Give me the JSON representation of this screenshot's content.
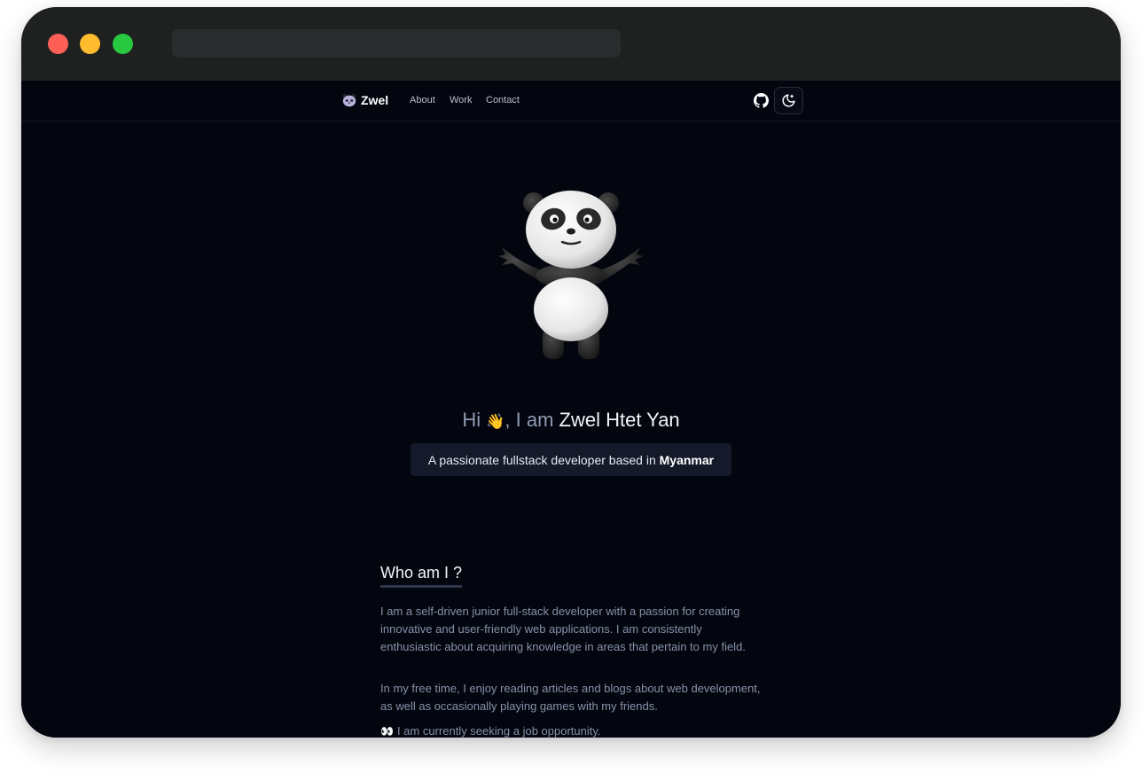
{
  "nav": {
    "brand": "Zwel",
    "links": [
      "About",
      "Work",
      "Contact"
    ]
  },
  "hero": {
    "greeting_prefix": "Hi",
    "wave_emoji": "👋",
    "greeting_mid": ", I am",
    "name": "Zwel Htet Yan",
    "tagline_prefix": "A passionate fullstack developer based in",
    "tagline_location": "Myanmar"
  },
  "about": {
    "title": "Who am I ?",
    "paragraph1": "I am a self-driven junior full-stack developer with a passion for creating innovative and user-friendly web applications. I am consistently enthusiastic about acquiring knowledge in areas that pertain to my field.",
    "paragraph2": "In my free time, I enjoy reading articles and blogs about web development, as well as occasionally playing games with my friends.",
    "eyes_emoji": "👀",
    "paragraph3": "I am currently seeking a job opportunity."
  },
  "icons": {
    "brand": "panda-icon",
    "github": "github-icon",
    "theme": "moon-icon",
    "traffic_lights": [
      "close-dot",
      "minimize-dot",
      "maximize-dot"
    ]
  },
  "colors": {
    "background": "#03050f",
    "titlebar": "#1f2020",
    "close": "#fe5f57",
    "minimize": "#febc2e",
    "maximize": "#28c840",
    "tagline_bg": "#141a2a"
  }
}
